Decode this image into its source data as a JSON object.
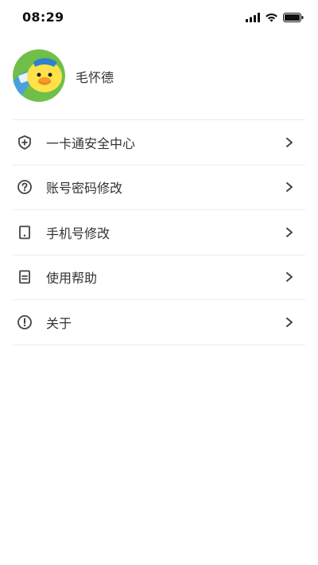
{
  "status_bar": {
    "time": "08:29",
    "icons": [
      "signal-icon",
      "wifi-icon",
      "battery-icon"
    ]
  },
  "profile": {
    "username": "毛怀德",
    "avatar_icon": "duck-avatar-icon"
  },
  "menu": {
    "items": [
      {
        "label": "一卡通安全中心",
        "icon": "shield-plus-icon"
      },
      {
        "label": "账号密码修改",
        "icon": "question-circle-icon"
      },
      {
        "label": "手机号修改",
        "icon": "tablet-icon"
      },
      {
        "label": "使用帮助",
        "icon": "document-icon"
      },
      {
        "label": "关于",
        "icon": "info-circle-icon"
      }
    ]
  },
  "colors": {
    "divider": "#ececec",
    "text": "#333333",
    "icon": "#444444"
  }
}
